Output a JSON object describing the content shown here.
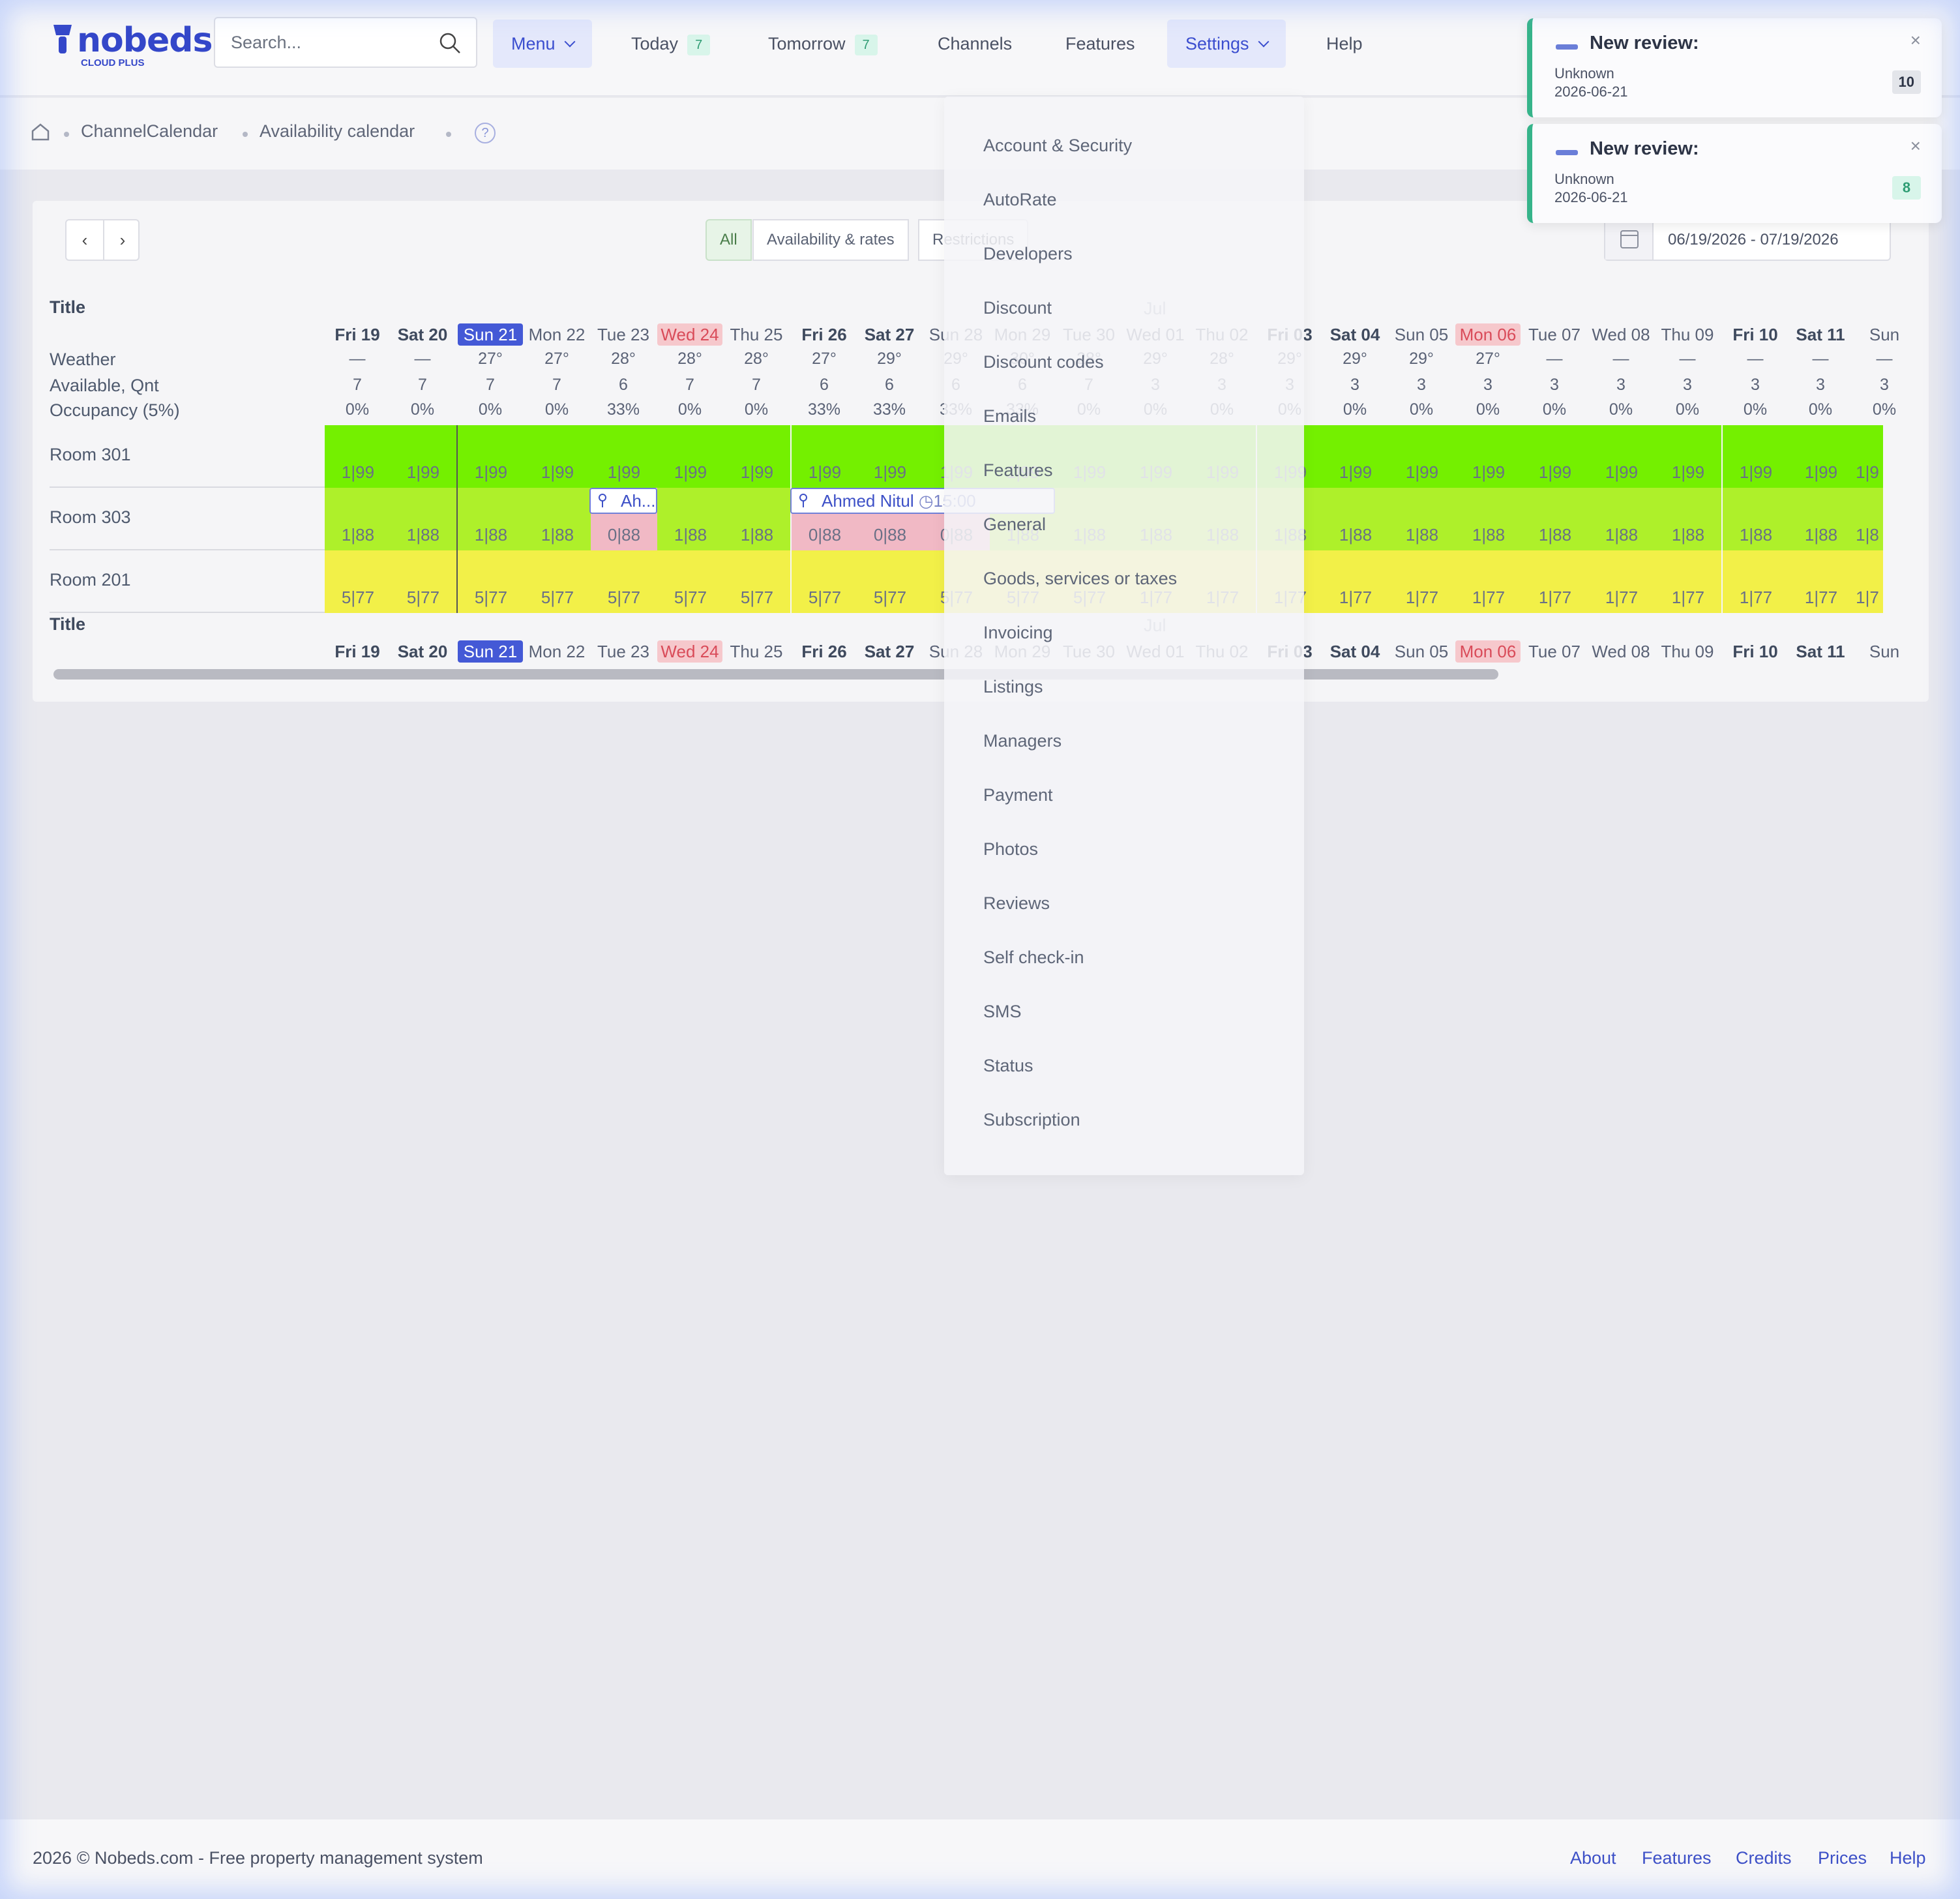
{
  "header": {
    "logo": "nobeds",
    "logo_sub": "CLOUD PLUS",
    "search_placeholder": "Search...",
    "nav": {
      "menu": "Menu",
      "today": "Today",
      "today_count": "7",
      "tomorrow": "Tomorrow",
      "tomorrow_count": "7",
      "channels": "Channels",
      "features": "Features",
      "settings": "Settings",
      "help": "Help"
    }
  },
  "breadcrumb": [
    "ChannelCalendar",
    "Availability calendar"
  ],
  "toolbar": {
    "prev": "‹",
    "next": "›",
    "filters": [
      "All",
      "Availability & rates",
      "Restrictions"
    ],
    "date_range": "06/19/2026 - 07/19/2026"
  },
  "calendar": {
    "title_label": "Title",
    "month_label": "Jul",
    "row_labels": {
      "weather": "Weather",
      "available": "Available, Qnt",
      "occupancy": "Occupancy (5%)"
    },
    "days": [
      {
        "label": "Fri 19",
        "weather": "—",
        "avail": "7",
        "occ": "0%"
      },
      {
        "label": "Sat 20",
        "weather": "—",
        "avail": "7",
        "occ": "0%"
      },
      {
        "label": "Sun 21",
        "weather": "27°",
        "avail": "7",
        "occ": "0%"
      },
      {
        "label": "Mon 22",
        "weather": "27°",
        "avail": "7",
        "occ": "0%"
      },
      {
        "label": "Tue 23",
        "weather": "28°",
        "avail": "6",
        "occ": "33%"
      },
      {
        "label": "Wed 24",
        "weather": "28°",
        "avail": "7",
        "occ": "0%"
      },
      {
        "label": "Thu 25",
        "weather": "28°",
        "avail": "7",
        "occ": "0%"
      },
      {
        "label": "Fri 26",
        "weather": "27°",
        "avail": "6",
        "occ": "33%"
      },
      {
        "label": "Sat 27",
        "weather": "29°",
        "avail": "6",
        "occ": "33%"
      },
      {
        "label": "Sun 28",
        "weather": "29°",
        "avail": "6",
        "occ": "33%"
      },
      {
        "label": "Mon 29",
        "weather": "30°",
        "avail": "6",
        "occ": "33%"
      },
      {
        "label": "Tue 30",
        "weather": "28°",
        "avail": "7",
        "occ": "0%"
      },
      {
        "label": "Wed 01",
        "weather": "29°",
        "avail": "3",
        "occ": "0%"
      },
      {
        "label": "Thu 02",
        "weather": "28°",
        "avail": "3",
        "occ": "0%"
      },
      {
        "label": "Fri 03",
        "weather": "29°",
        "avail": "3",
        "occ": "0%"
      },
      {
        "label": "Sat 04",
        "weather": "29°",
        "avail": "3",
        "occ": "0%"
      },
      {
        "label": "Sun 05",
        "weather": "29°",
        "avail": "3",
        "occ": "0%"
      },
      {
        "label": "Mon 06",
        "weather": "27°",
        "avail": "3",
        "occ": "0%"
      },
      {
        "label": "Tue 07",
        "weather": "—",
        "avail": "3",
        "occ": "0%"
      },
      {
        "label": "Wed 08",
        "weather": "—",
        "avail": "3",
        "occ": "0%"
      },
      {
        "label": "Thu 09",
        "weather": "—",
        "avail": "3",
        "occ": "0%"
      },
      {
        "label": "Fri 10",
        "weather": "—",
        "avail": "3",
        "occ": "0%"
      },
      {
        "label": "Sat 11",
        "weather": "—",
        "avail": "3",
        "occ": "0%"
      },
      {
        "label": "Sun",
        "weather": "—",
        "avail": "3",
        "occ": "0%"
      }
    ],
    "rooms": [
      {
        "name": "Room 301",
        "values": [
          "1|99",
          "1|99",
          "1|99",
          "1|99",
          "1|99",
          "1|99",
          "1|99",
          "1|99",
          "1|99",
          "1|99",
          "1|99",
          "1|99",
          "1|99",
          "1|99",
          "1|99",
          "1|99",
          "1|99",
          "1|99",
          "1|99",
          "1|99",
          "1|99",
          "1|99",
          "1|99",
          "1|9"
        ]
      },
      {
        "name": "Room 303",
        "values": [
          "1|88",
          "1|88",
          "1|88",
          "1|88",
          "0|88",
          "1|88",
          "1|88",
          "0|88",
          "0|88",
          "0|88",
          "1|88",
          "1|88",
          "1|88",
          "1|88",
          "1|88",
          "1|88",
          "1|88",
          "1|88",
          "1|88",
          "1|88",
          "1|88",
          "1|88",
          "1|88",
          "1|8"
        ]
      },
      {
        "name": "Room 201",
        "values": [
          "5|77",
          "5|77",
          "5|77",
          "5|77",
          "5|77",
          "5|77",
          "5|77",
          "5|77",
          "5|77",
          "5|77",
          "5|77",
          "5|77",
          "1|77",
          "1|77",
          "1|77",
          "1|77",
          "1|77",
          "1|77",
          "1|77",
          "1|77",
          "1|77",
          "1|77",
          "1|77",
          "1|7"
        ]
      }
    ],
    "bookings": [
      {
        "label": "Ah..."
      },
      {
        "label": "Ahmed Nitul",
        "time": "15:00"
      }
    ]
  },
  "settings_menu": [
    "Account & Security",
    "AutoRate",
    "Developers",
    "Discount",
    "Discount codes",
    "Emails",
    "Features",
    "General",
    "Goods, services or taxes",
    "Invoicing",
    "Listings",
    "Managers",
    "Payment",
    "Photos",
    "Reviews",
    "Self check-in",
    "SMS",
    "Status",
    "Subscription"
  ],
  "toasts": [
    {
      "title": "New review:",
      "line1": "Unknown",
      "line2": "2026-06-21",
      "badge": "10",
      "close": "×"
    },
    {
      "title": "New review:",
      "line1": "Unknown",
      "line2": "2026-06-21",
      "badge": "8",
      "close": "×"
    }
  ],
  "footer": {
    "copyright": "2026  © Nobeds.com - Free property management system",
    "links": [
      "About",
      "Features",
      "Credits",
      "Prices",
      "Help"
    ]
  },
  "colors": {
    "brand": "#3447c9",
    "room301": "#74f000",
    "room303": "#aef02a",
    "room201": "#f2f048",
    "booked_cell": "#f1b9c5",
    "toast_accent": "#36b48a"
  }
}
